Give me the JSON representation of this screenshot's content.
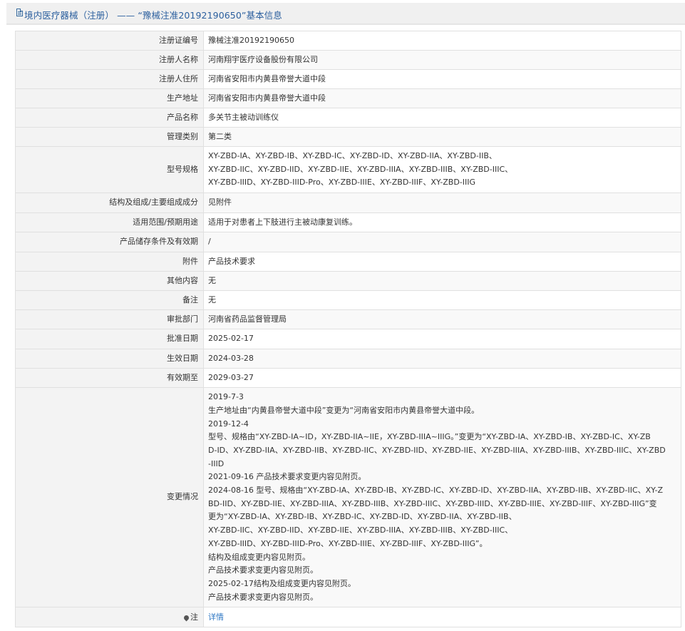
{
  "header": {
    "title": "境内医疗器械（注册） —— “豫械注准20192190650”基本信息",
    "icon": "document-icon"
  },
  "rows": [
    {
      "label": "注册证编号",
      "value": "豫械注准20192190650"
    },
    {
      "label": "注册人名称",
      "value": "河南翔宇医疗设备股份有限公司"
    },
    {
      "label": "注册人住所",
      "value": "河南省安阳市内黄县帝誉大道中段"
    },
    {
      "label": "生产地址",
      "value": "河南省安阳市内黄县帝誉大道中段"
    },
    {
      "label": "产品名称",
      "value": "多关节主被动训练仪"
    },
    {
      "label": "管理类别",
      "value": "第二类"
    },
    {
      "label": "型号规格",
      "lines": [
        "XY-ZBD-IA、XY-ZBD-IB、XY-ZBD-IC、XY-ZBD-ID、XY-ZBD-IIA、XY-ZBD-IIB、",
        "XY-ZBD-IIC、XY-ZBD-IID、XY-ZBD-IIE、XY-ZBD-IIIA、XY-ZBD-IIIB、XY-ZBD-IIIC、",
        "XY-ZBD-IIID、XY-ZBD-IIID-Pro、XY-ZBD-IIIE、XY-ZBD-IIIF、XY-ZBD-IIIG"
      ]
    },
    {
      "label": "结构及组成/主要组成成分",
      "value": "见附件"
    },
    {
      "label": "适用范围/预期用途",
      "value": "适用于对患者上下肢进行主被动康复训练。"
    },
    {
      "label": "产品储存条件及有效期",
      "value": "/"
    },
    {
      "label": "附件",
      "value": "产品技术要求"
    },
    {
      "label": "其他内容",
      "value": "无"
    },
    {
      "label": "备注",
      "value": "无"
    },
    {
      "label": "审批部门",
      "value": "河南省药品监督管理局"
    },
    {
      "label": "批准日期",
      "value": "2025-02-17"
    },
    {
      "label": "生效日期",
      "value": "2024-03-28"
    },
    {
      "label": "有效期至",
      "value": "2029-03-27"
    },
    {
      "label": "变更情况",
      "lines": [
        "2019-7-3",
        "生产地址由“内黄县帝誉大道中段”变更为“河南省安阳市内黄县帝誉大道中段。",
        "2019-12-4",
        "型号、规格由“XY-ZBD-IA~ID，XY-ZBD-IIA~IIE，XY-ZBD-IIIA~IIIG。”变更为“XY-ZBD-IA、XY-ZBD-IB、XY-ZBD-IC、XY-ZB",
        "D-ID、XY-ZBD-IIA、XY-ZBD-IIB、XY-ZBD-IIC、XY-ZBD-IID、XY-ZBD-IIE、XY-ZBD-IIIA、XY-ZBD-IIIB、XY-ZBD-IIIC、XY-ZBD",
        "-IIID",
        "2021-09-16 产品技术要求变更内容见附页。",
        "2024-08-16 型号、规格由“XY-ZBD-IA、XY-ZBD-IB、XY-ZBD-IC、XY-ZBD-ID、XY-ZBD-IIA、XY-ZBD-IIB、XY-ZBD-IIC、XY-Z",
        "BD-IID、XY-ZBD-IIE、XY-ZBD-IIIA、XY-ZBD-IIIB、XY-ZBD-IIIC、XY-ZBD-IIID、XY-ZBD-IIIE、XY-ZBD-IIIF、XY-ZBD-IIIG”变",
        "更为“XY-ZBD-IA、XY-ZBD-IB、XY-ZBD-IC、XY-ZBD-ID、XY-ZBD-IIA、XY-ZBD-IIB、",
        "XY-ZBD-IIC、XY-ZBD-IID、XY-ZBD-IIE、XY-ZBD-IIIA、XY-ZBD-IIIB、XY-ZBD-IIIC、",
        "XY-ZBD-IIID、XY-ZBD-IIID-Pro、XY-ZBD-IIIE、XY-ZBD-IIIF、XY-ZBD-IIIG”。",
        "结构及组成变更内容见附页。",
        "产品技术要求变更内容见附页。",
        "2025-02-17结构及组成变更内容见附页。",
        "产品技术要求变更内容见附页。"
      ]
    },
    {
      "label": "注",
      "value": "详情",
      "icon": "pin-icon",
      "link": true
    }
  ]
}
